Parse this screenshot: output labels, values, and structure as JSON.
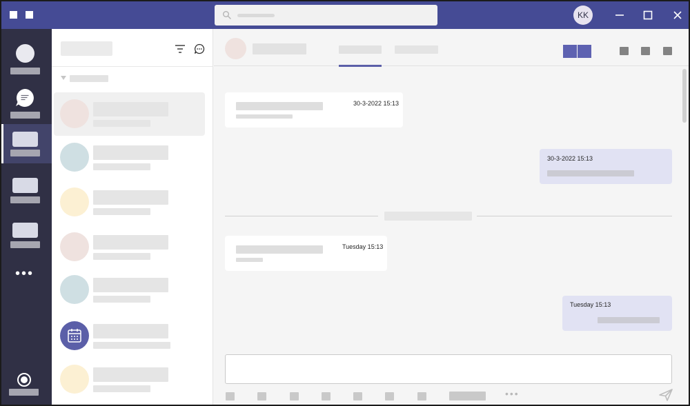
{
  "colors": {
    "titlebar": "#454b95",
    "rail": "#303045",
    "accent": "#5b5fa8",
    "outgoing_bubble": "#e1e2f3",
    "incoming_bubble": "#ffffff"
  },
  "titlebar": {
    "user_initials": "KK",
    "icons": [
      "window-square-icon",
      "window-square-icon",
      "search-icon",
      "minimize-icon",
      "maximize-icon",
      "close-icon"
    ]
  },
  "rail": {
    "icons": [
      "activity-icon",
      "chat-icon",
      "teams-icon",
      "calendar-icon",
      "calls-icon",
      "more-icon",
      "status-icon"
    ],
    "more_label": "•••",
    "active_index": 2
  },
  "chat_list": {
    "icons": [
      "filter-icon",
      "new-chat-icon",
      "calendar-icon"
    ],
    "avatar_colors": [
      "#efe2df",
      "#cfdfe3",
      "#fcf0d3",
      "#efe2df",
      "#cfdfe3",
      "#5b5fa8",
      "#fcf0d3"
    ],
    "selected_index": 0
  },
  "conversation": {
    "header_icons": [
      "video-call-icon",
      "audio-call-icon"
    ],
    "messages": [
      {
        "direction": "in",
        "time": "30-3-2022  15:13"
      },
      {
        "direction": "out",
        "time": "30-3-2022  15:13"
      },
      {
        "direction": "in",
        "time": "Tuesday 15:13"
      },
      {
        "direction": "out",
        "time": "Tuesday 15:13"
      }
    ],
    "compose_more": "•••",
    "compose_icons": [
      "send-icon"
    ]
  }
}
